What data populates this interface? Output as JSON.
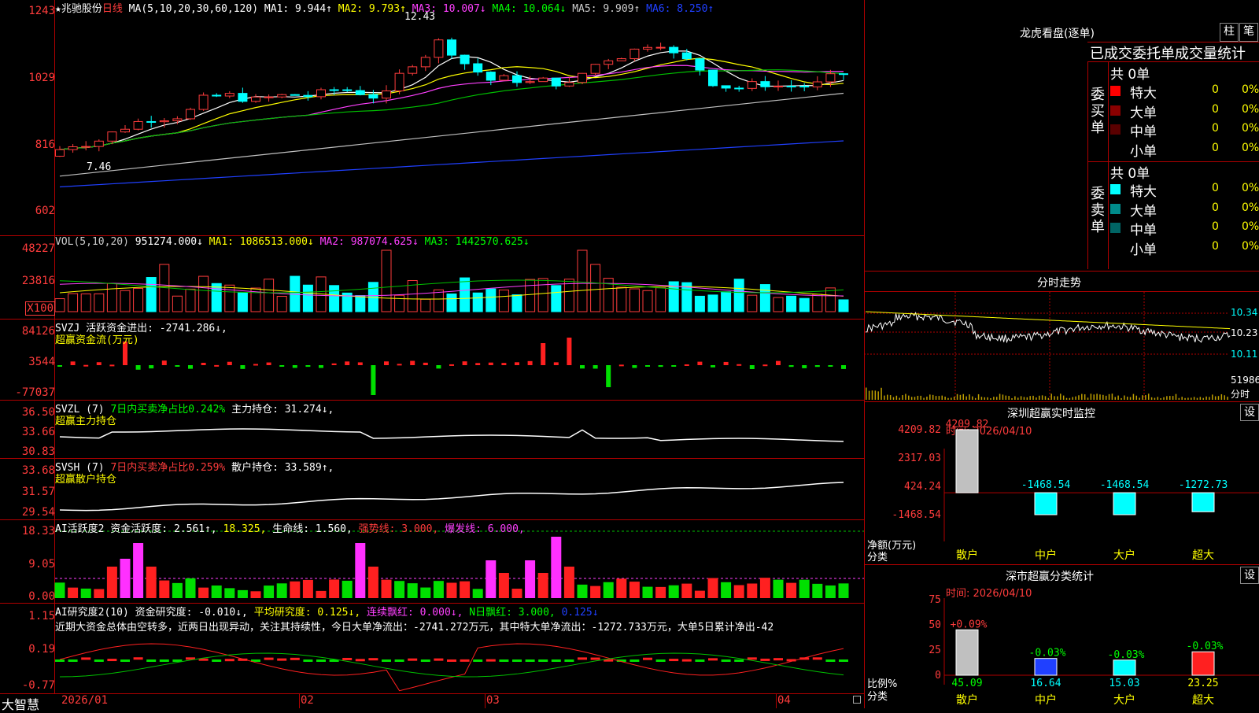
{
  "kline": {
    "stock_name": "★兆驰股份",
    "period": "日线",
    "ma_title": "MA(5,10,20,30,60,120)",
    "ma1": "MA1: 9.944↑",
    "ma2": "MA2: 9.793↑",
    "ma3": "MA3: 10.007↓",
    "ma4": "MA4: 10.064↓",
    "ma5": "MA5: 9.909↑",
    "ma6": "MA6: 8.250↑",
    "high_label": "12.43",
    "low_label": "7.46",
    "yaxis": [
      "1243",
      "1029",
      "816",
      "602"
    ]
  },
  "volume": {
    "title": "VOL(5,10,20)",
    "value": "951274.000↓",
    "ma1": "MA1: 1086513.000↓",
    "ma2": "MA2: 987074.625↓",
    "ma3": "MA3: 1442570.625↓",
    "yaxis": [
      "48227",
      "23816",
      "X100"
    ]
  },
  "svzj": {
    "title": "SVZJ  活跃资金进出: -2741.286↓,",
    "subtitle": "超赢资金流(万元)",
    "yaxis": [
      "84126",
      "3544",
      "-77037"
    ]
  },
  "svzl": {
    "title": "SVZL (7)",
    "ratio": "7日内买卖净占比0.242%",
    "holding": "主力持仓: 31.274↓,",
    "subtitle": "超赢主力持仓",
    "yaxis": [
      "36.50",
      "33.66",
      "30.83"
    ]
  },
  "svsh": {
    "title": "SVSH (7)",
    "ratio": "7日内买卖净占比0.259%",
    "holding": "散户持仓: 33.589↑,",
    "subtitle": "超赢散户持仓",
    "yaxis": [
      "33.68",
      "31.57",
      "29.54"
    ]
  },
  "ai_active": {
    "title": "AI活跃度2 资金活跃度: 2.561↑,",
    "v2": "18.325,",
    "life": "生命线: 1.560,",
    "strong": "强势线: 3.000,",
    "burst": "爆发线: 6.000,",
    "yaxis": [
      "18.33",
      "9.05",
      "0.00"
    ]
  },
  "ai_research": {
    "title": "AI研究度2(10) 资金研究度: -0.010↓,",
    "avg": "平均研究度: 0.125↓,",
    "cont": "连续飘红: 0.000↓,",
    "nday": "N日飘红: 3.000,",
    "last": "0.125↓",
    "commentary": "近期大资金总体由空转多，近两日出现异动，关注其持续性，今日大单净流出：-2741.272万元，其中特大单净流出：-1272.733万元，大单5日累计净出-42",
    "yaxis": [
      "1.15",
      "0.19",
      "-0.77"
    ]
  },
  "xaxis": {
    "brand": "大智慧",
    "labels": [
      "2026/01",
      "02",
      "03",
      "04"
    ]
  },
  "dragon_tiger": {
    "title": "龙虎看盘(逐单)",
    "btn1": "柱",
    "btn2": "笔",
    "header": "已成交委托单成交量统计",
    "buy_label": "委买单",
    "sell_label": "委卖单",
    "buy_total": "共 0单",
    "sell_total": "共 0单",
    "buy_rows": [
      {
        "name": "特大",
        "count": "0",
        "pct": "0%",
        "color": "#ff0000"
      },
      {
        "name": "大单",
        "count": "0",
        "pct": "0%",
        "color": "#8b0000"
      },
      {
        "name": "中单",
        "count": "0",
        "pct": "0%",
        "color": "#5a0000"
      },
      {
        "name": "小单",
        "count": "0",
        "pct": "0%",
        "color": "#000000"
      }
    ],
    "sell_rows": [
      {
        "name": "特大",
        "count": "0",
        "pct": "0%",
        "color": "#00ffff"
      },
      {
        "name": "大单",
        "count": "0",
        "pct": "0%",
        "color": "#008b8b"
      },
      {
        "name": "中单",
        "count": "0",
        "pct": "0%",
        "color": "#006464"
      },
      {
        "name": "小单",
        "count": "0",
        "pct": "0%",
        "color": "#000000"
      }
    ]
  },
  "intraday": {
    "title": "分时走势",
    "yaxis": [
      "10.34",
      "10.23",
      "10.11"
    ],
    "vol_label": "51986",
    "small_label": "分时"
  },
  "sz_monitor": {
    "title": "深圳超赢实时监控",
    "btn": "设",
    "time": "时间: 2026/04/10",
    "yaxis": [
      "4209.82",
      "2317.03",
      "424.24",
      "-1468.54"
    ],
    "ylabel": "净额(万元)",
    "xlabel": "分类",
    "categories": [
      "散户",
      "中户",
      "大户",
      "超大"
    ],
    "values": [
      4209.82,
      -1468.54,
      -1468.54,
      -1272.73
    ],
    "value_labels": [
      "4209.82",
      "-1468.54",
      "-1468.54",
      "-1272.73"
    ]
  },
  "sz_class": {
    "title": "深市超赢分类统计",
    "btn": "设",
    "time": "时间: 2026/04/10",
    "yaxis": [
      "75",
      "50",
      "25",
      "0"
    ],
    "ylabel": "比例%",
    "xlabel": "分类",
    "categories": [
      "散户",
      "中户",
      "大户",
      "超大"
    ],
    "values": [
      45.09,
      16.64,
      15.03,
      23.25
    ],
    "value_labels": [
      "45.09",
      "16.64",
      "15.03",
      "23.25"
    ],
    "change_labels": [
      "+0.09%",
      "-0.03%",
      "-0.03%",
      "-0.03%"
    ]
  },
  "chart_data": [
    {
      "type": "candlestick",
      "title": "兆驰股份 日线",
      "x": [
        "2026/01",
        "02",
        "03",
        "04"
      ],
      "ylim": [
        6.02,
        12.43
      ],
      "annotations": {
        "high": 12.43,
        "low": 7.46
      },
      "ma": {
        "MA1": 9.944,
        "MA2": 9.793,
        "MA3": 10.007,
        "MA4": 10.064,
        "MA5": 9.909,
        "MA6": 8.25
      }
    },
    {
      "type": "bar",
      "title": "深圳超赢实时监控",
      "categories": [
        "散户",
        "中户",
        "大户",
        "超大"
      ],
      "values": [
        4209.82,
        -1468.54,
        -1468.54,
        -1272.73
      ],
      "ylabel": "净额(万元)"
    },
    {
      "type": "bar",
      "title": "深市超赢分类统计",
      "categories": [
        "散户",
        "中户",
        "大户",
        "超大"
      ],
      "values": [
        45.09,
        16.64,
        15.03,
        23.25
      ],
      "ylabel": "比例%",
      "ylim": [
        0,
        75
      ]
    }
  ]
}
